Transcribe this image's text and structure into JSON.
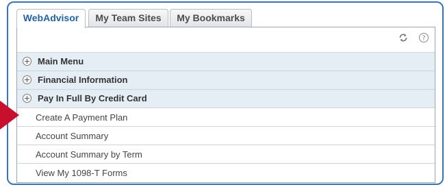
{
  "tabs": [
    {
      "label": "WebAdvisor",
      "active": true
    },
    {
      "label": "My Team Sites",
      "active": false
    },
    {
      "label": "My Bookmarks",
      "active": false
    }
  ],
  "toolbar": {
    "refresh_icon": "refresh-icon",
    "help_icon": "help-icon",
    "refresh_symbol": "⟳",
    "help_symbol": "?"
  },
  "sections": [
    {
      "label": "Main Menu",
      "icon": "expand-plus-icon"
    },
    {
      "label": "Financial Information",
      "icon": "expand-plus-icon"
    },
    {
      "label": "Pay In Full By Credit Card",
      "icon": "expand-plus-icon"
    }
  ],
  "links": [
    {
      "label": "Create A Payment Plan"
    },
    {
      "label": "Account Summary"
    },
    {
      "label": "Account Summary by Term"
    },
    {
      "label": "View My 1098-T Forms"
    }
  ],
  "colors": {
    "frame": "#2f74c6",
    "active_tab_text": "#1e62b0",
    "section_bg": "#e6eef5",
    "pointer_arrow": "#c8102e"
  }
}
